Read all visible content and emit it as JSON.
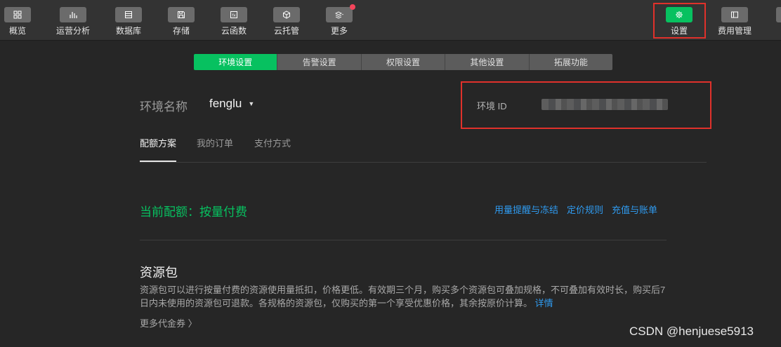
{
  "toolbar": {
    "items": [
      {
        "label": "概览",
        "icon": "grid-icon"
      },
      {
        "label": "运营分析",
        "icon": "bar-chart-icon"
      },
      {
        "label": "数据库",
        "icon": "database-icon"
      },
      {
        "label": "存储",
        "icon": "save-icon"
      },
      {
        "label": "云函数",
        "icon": "function-icon"
      },
      {
        "label": "云托管",
        "icon": "cube-icon"
      },
      {
        "label": "更多",
        "icon": "layers-icon"
      }
    ],
    "right_items": [
      {
        "label": "设置",
        "icon": "gear-icon"
      },
      {
        "label": "费用管理",
        "icon": "sidebar-panel-icon"
      }
    ]
  },
  "tabs": [
    "环境设置",
    "告警设置",
    "权限设置",
    "其他设置",
    "拓展功能"
  ],
  "env": {
    "name_label": "环境名称",
    "name_value": "fenglu",
    "id_label": "环境 ID"
  },
  "subtabs": [
    "配额方案",
    "我的订单",
    "支付方式"
  ],
  "plan": {
    "current": "当前配额：按量付费",
    "links": [
      "用量提醒与冻结",
      "定价规则",
      "充值与账单"
    ]
  },
  "resource": {
    "title": "资源包",
    "description": "资源包可以进行按量付费的资源使用量抵扣，价格更低。有效期三个月，购买多个资源包可叠加规格，不可叠加有效时长，购买后7日内未使用的资源包可退款。各规格的资源包，仅购买的第一个享受优惠价格，其余按原价计算。",
    "detail_link": "详情",
    "more_coupons": "更多代金券 〉"
  },
  "watermark": "CSDN @henjuese5913",
  "colors": {
    "accent": "#07c160",
    "link": "#2f9bf0",
    "highlight": "#e0312b",
    "badge": "#f5455b"
  }
}
